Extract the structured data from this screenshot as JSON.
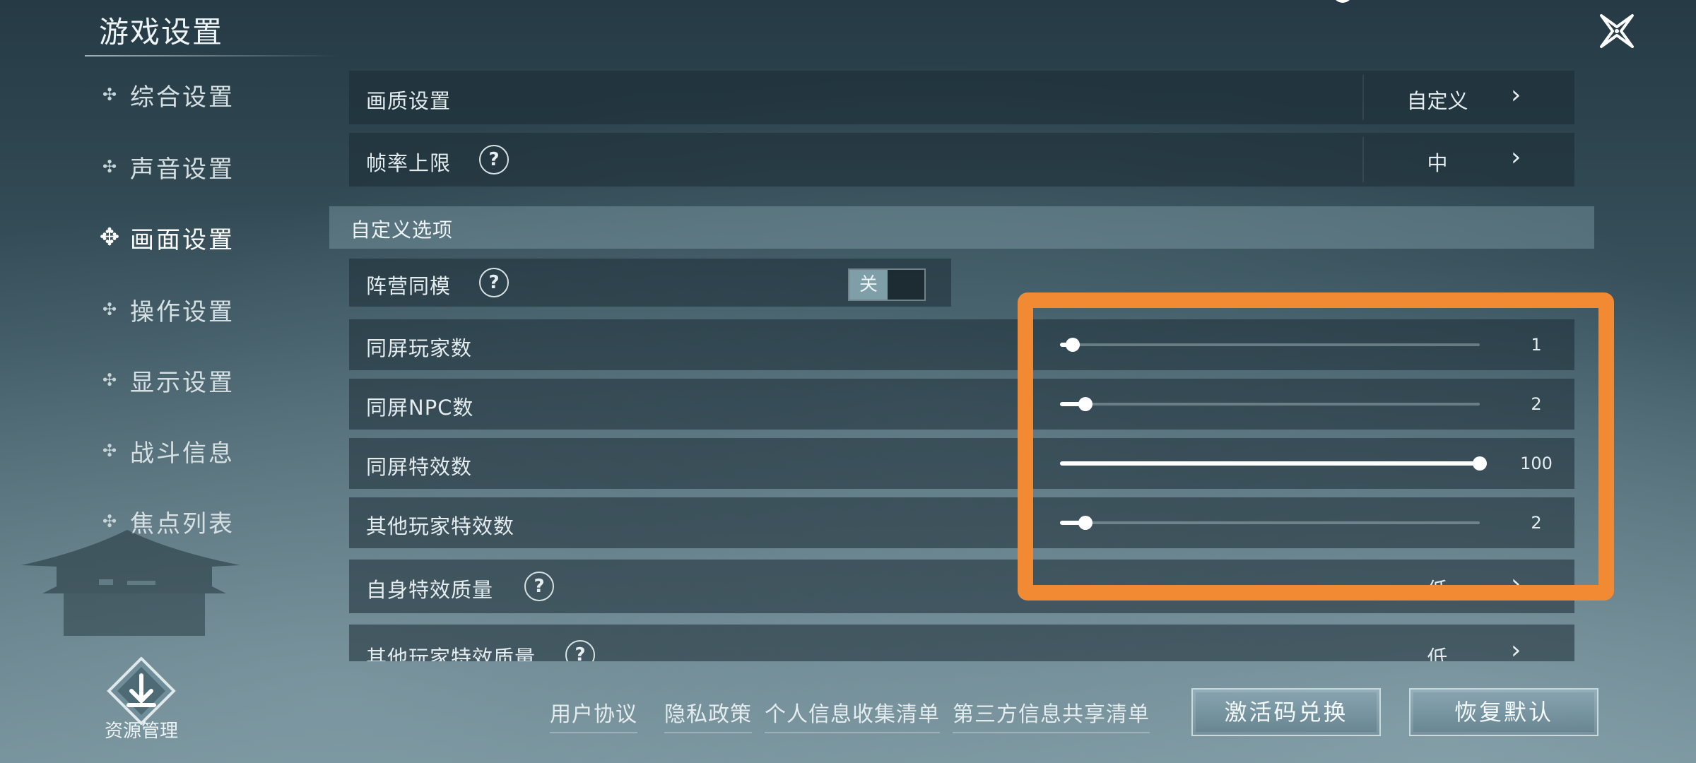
{
  "header": {
    "title": "游戏设置"
  },
  "sidebar": {
    "items": [
      {
        "label": "综合设置",
        "active": false
      },
      {
        "label": "声音设置",
        "active": false
      },
      {
        "label": "画面设置",
        "active": true
      },
      {
        "label": "操作设置",
        "active": false
      },
      {
        "label": "显示设置",
        "active": false
      },
      {
        "label": "战斗信息",
        "active": false
      },
      {
        "label": "焦点列表",
        "active": false
      }
    ],
    "resource_manager": "资源管理"
  },
  "settings": {
    "quality": {
      "label": "画质设置",
      "value": "自定义"
    },
    "framerate": {
      "label": "帧率上限",
      "value": "中"
    },
    "section_custom": "自定义选项",
    "same_model": {
      "label": "阵营同模",
      "toggle": "关"
    },
    "sliders": [
      {
        "label": "同屏玩家数",
        "value": "1",
        "fraction": 0.03
      },
      {
        "label": "同屏NPC数",
        "value": "2",
        "fraction": 0.06
      },
      {
        "label": "同屏特效数",
        "value": "100",
        "fraction": 1.0
      },
      {
        "label": "其他玩家特效数",
        "value": "2",
        "fraction": 0.06
      }
    ],
    "self_effect_quality": {
      "label": "自身特效质量",
      "value": "低"
    },
    "other_effect_quality": {
      "label": "其他玩家特效质量",
      "value": "低"
    }
  },
  "footer": {
    "links": [
      "用户协议",
      "隐私政策",
      "个人信息收集清单",
      "第三方信息共享清单"
    ],
    "activate_button": "激活码兑换",
    "reset_button": "恢复默认"
  },
  "colors": {
    "highlight": "#f28a33",
    "toggle_on": "#7e9ea8"
  }
}
